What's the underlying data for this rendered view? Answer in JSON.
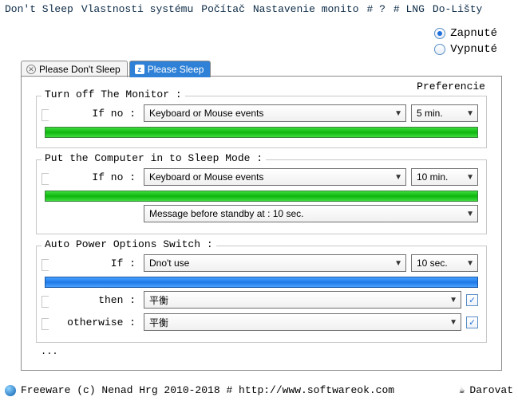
{
  "menu": {
    "items": [
      "Don't Sleep",
      "Vlastnosti systému",
      "Počítač",
      "Nastavenie monito",
      "# ?",
      "# LNG",
      "Do-Lišty"
    ]
  },
  "radios": {
    "on": "Zapnuté",
    "off": "Vypnuté"
  },
  "tabs": {
    "inactive": "Please Don't Sleep",
    "active": "Please Sleep"
  },
  "prefs": "Preferencie",
  "group1": {
    "title": "Turn off The Monitor :",
    "label": "If no :",
    "event": "Keyboard or Mouse events",
    "time": "5 min."
  },
  "group2": {
    "title": "Put the Computer in to Sleep Mode :",
    "label": "If no :",
    "event": "Keyboard or Mouse events",
    "time": "10 min.",
    "msg": "Message before standby at : 10 sec."
  },
  "group3": {
    "title": "Auto Power Options Switch :",
    "if_label": "If :",
    "if_value": "Dno't use",
    "if_time": "10 sec.",
    "then_label": "then :",
    "then_value": "平衡",
    "otherwise_label": "otherwise :",
    "otherwise_value": "平衡"
  },
  "ellipsis": "...",
  "footer": {
    "text": "Freeware (c) Nenad Hrg 2010-2018 # http://www.softwareok.com",
    "donate": "Darovat"
  }
}
